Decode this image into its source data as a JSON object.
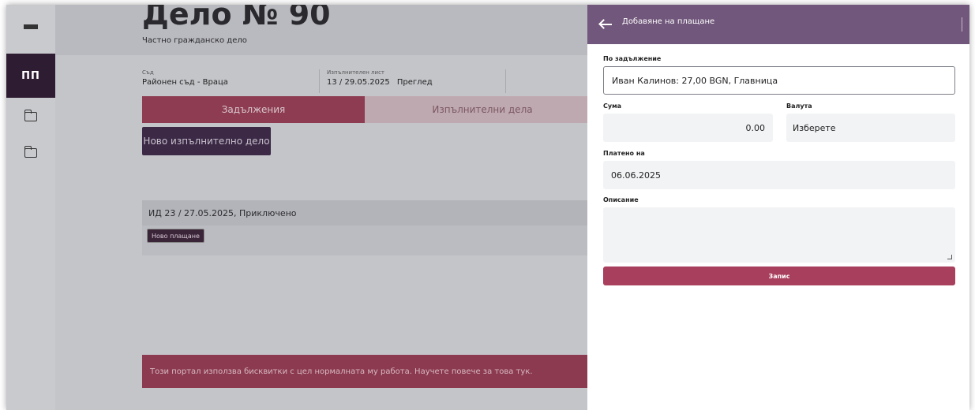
{
  "rail": {
    "brand": "ПП"
  },
  "case": {
    "title": "Дело № 90",
    "subtitle": "Частно гражданско дело",
    "court_label": "Съд",
    "court_value": "Районен съд - Враца",
    "writ_label": "Изпълнителен лист",
    "writ_value": "13 / 29.05.2025",
    "writ_link": "Преглед"
  },
  "tabs": [
    {
      "label": "Задължения"
    },
    {
      "label": "Изпълнителни дела"
    }
  ],
  "actions": {
    "new_enforcement_case": "Ново изпълнително дело"
  },
  "enforcement_case": {
    "heading": "ИД 23 / 27.05.2025, Приключено",
    "new_payment": "Ново плащане"
  },
  "cookie_banner": {
    "text": "Този портал използва бисквитки с цел нормалната му работа. Научете повече за това тук."
  },
  "drawer": {
    "title": "Добавяне на плащане",
    "obligation_label": "По задължение",
    "obligation_value": "Иван Калинов: 27,00 BGN, Главница",
    "amount_label": "Сума",
    "amount_value": "0.00",
    "currency_label": "Валута",
    "currency_value": "Изберете",
    "paid_on_label": "Платено на",
    "paid_on_value": "06.06.2025",
    "description_label": "Описание",
    "description_value": "",
    "save_label": "Запис"
  },
  "colors": {
    "drawer_header": "#71577b",
    "save_button": "#a83f5c",
    "brand_tile": "#2e1c33"
  }
}
